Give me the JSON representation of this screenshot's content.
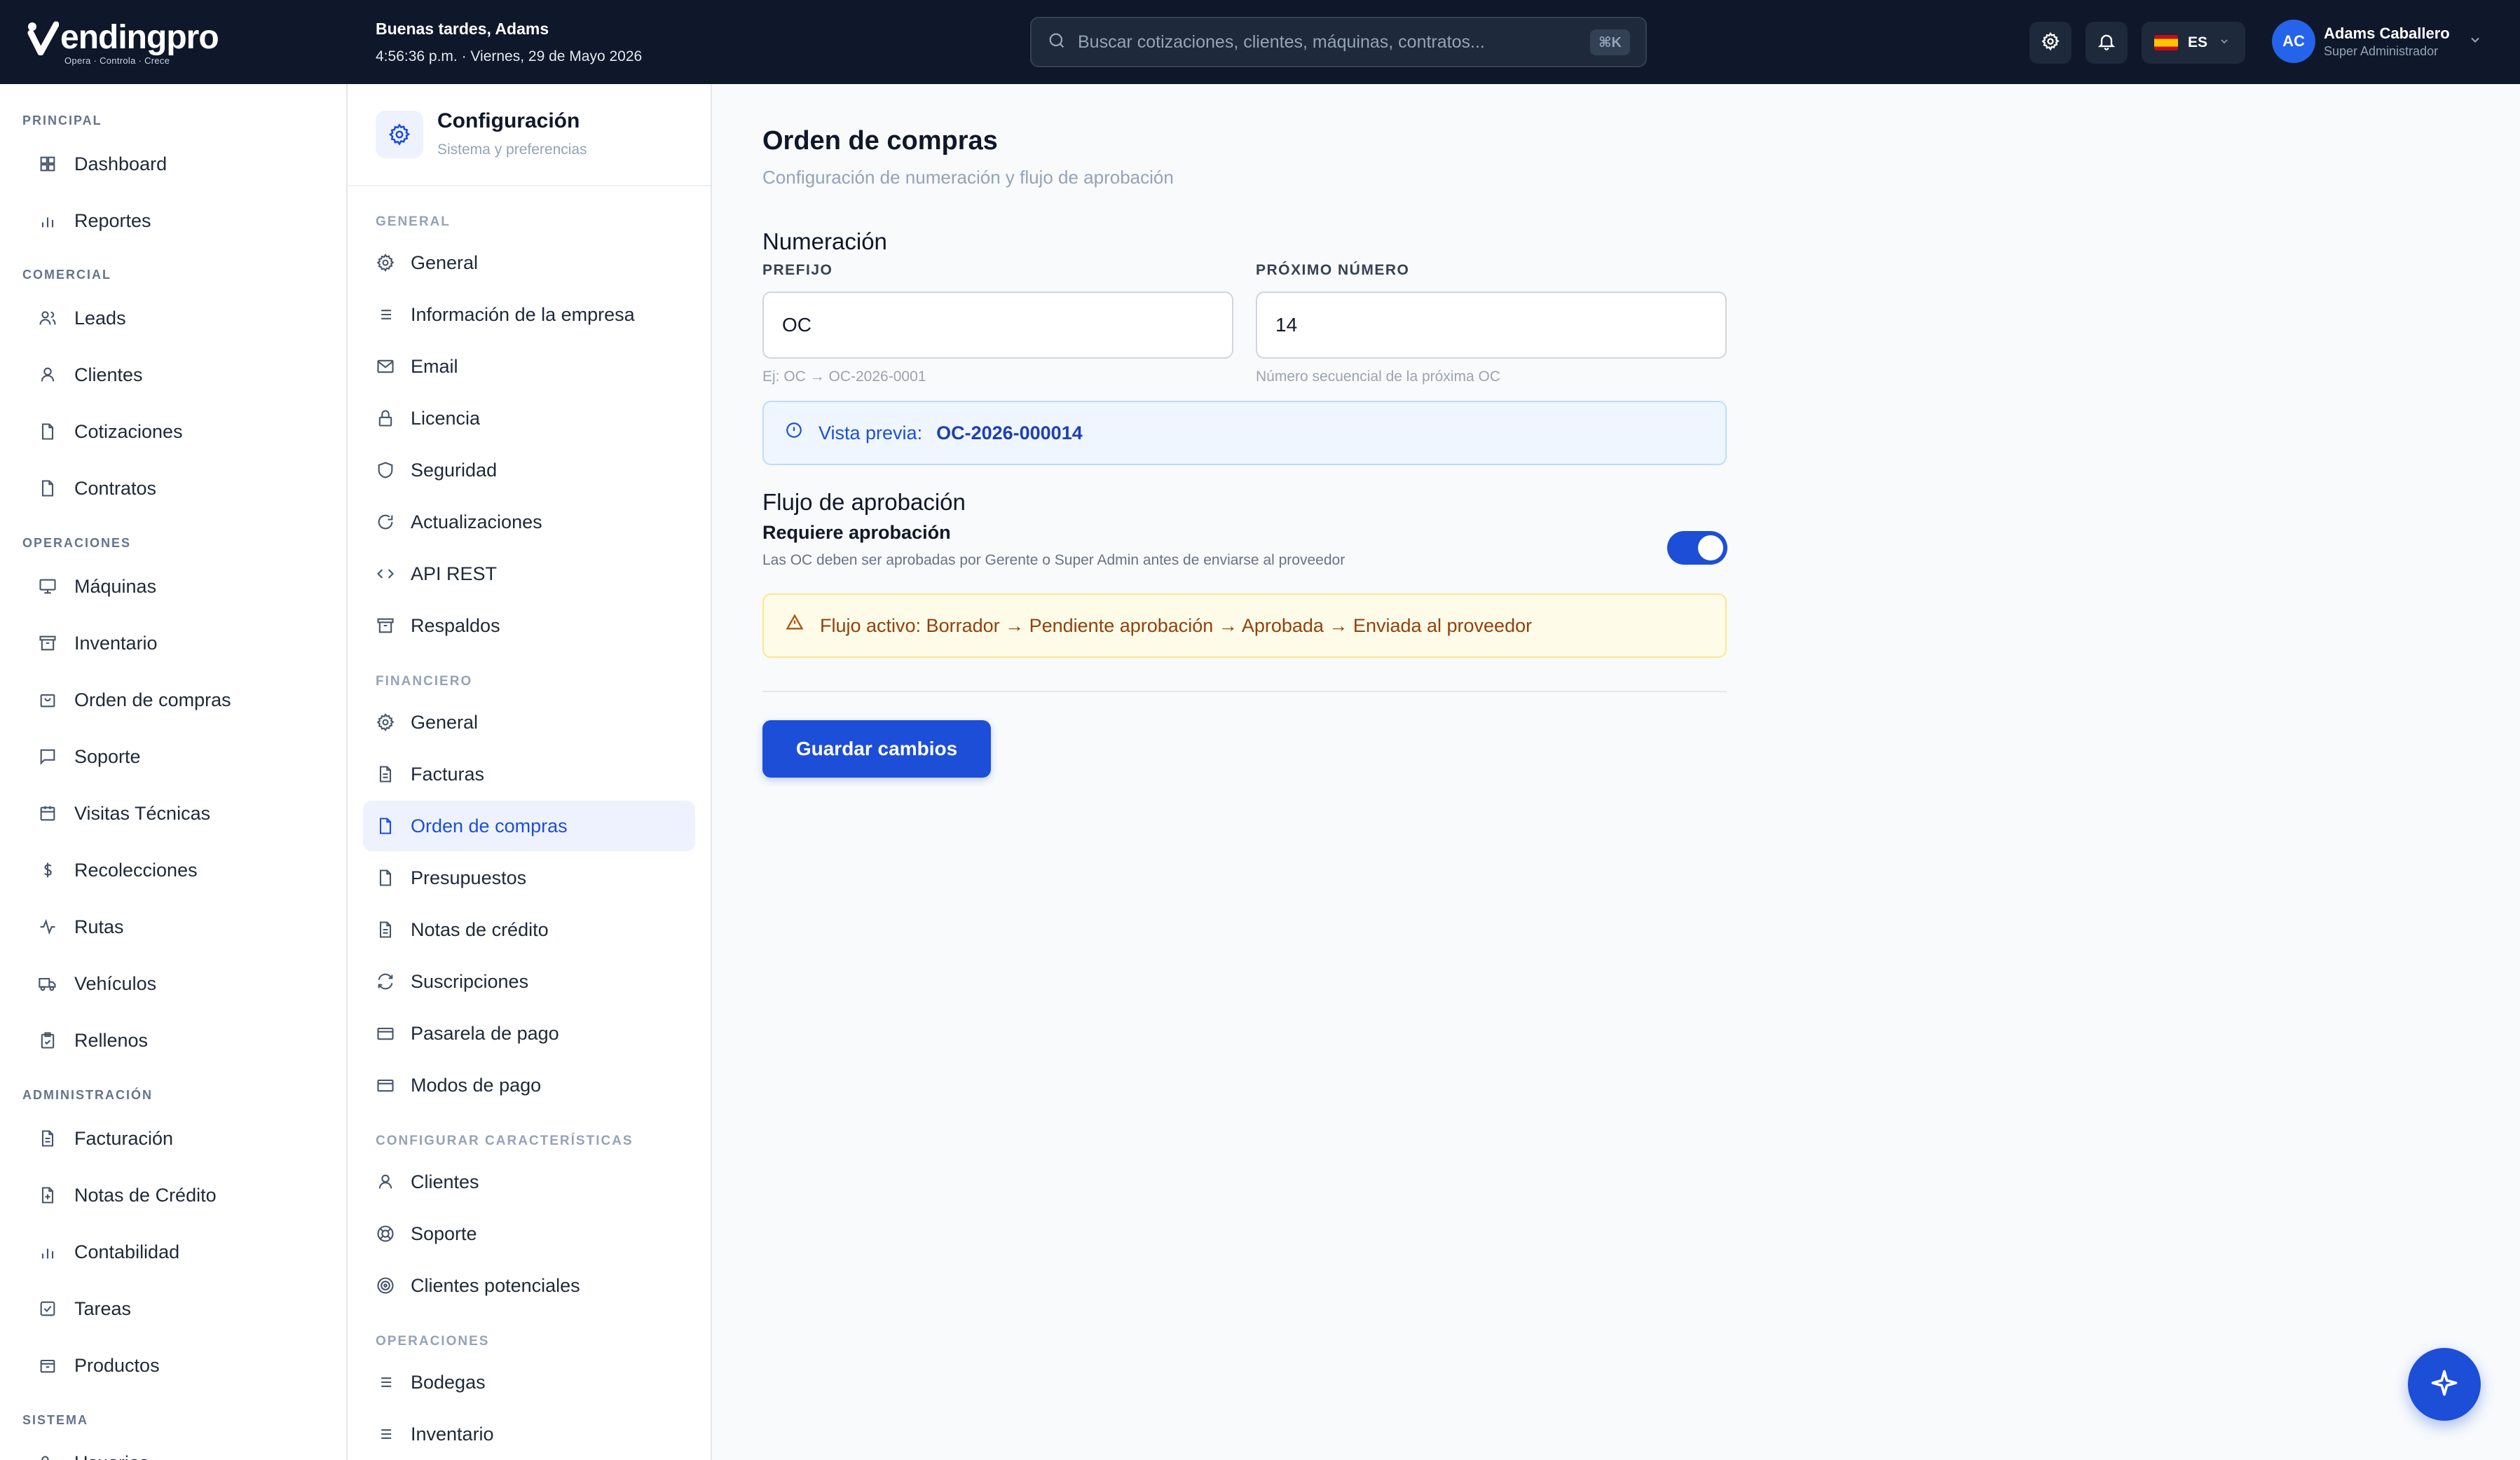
{
  "app": {
    "logo_text": "endingpro",
    "logo_tagline": "Opera · Controla · Crece",
    "greeting": "Buenas tardes, Adams",
    "datetime": "4:56:36 p.m. · Viernes, 29 de Mayo 2026",
    "search_placeholder": "Buscar cotizaciones, clientes, máquinas, contratos...",
    "search_shortcut": "⌘K",
    "language": "ES",
    "user": {
      "initials": "AC",
      "name": "Adams Caballero",
      "role": "Super Administrador"
    }
  },
  "sidebar": {
    "sections": [
      {
        "label": "PRINCIPAL",
        "items": [
          "Dashboard",
          "Reportes"
        ]
      },
      {
        "label": "COMERCIAL",
        "items": [
          "Leads",
          "Clientes",
          "Cotizaciones",
          "Contratos"
        ]
      },
      {
        "label": "OPERACIONES",
        "items": [
          "Máquinas",
          "Inventario",
          "Orden de compras",
          "Soporte",
          "Visitas Técnicas",
          "Recolecciones",
          "Rutas",
          "Vehículos",
          "Rellenos"
        ]
      },
      {
        "label": "ADMINISTRACIÓN",
        "items": [
          "Facturación",
          "Notas de Crédito",
          "Contabilidad",
          "Tareas",
          "Productos"
        ]
      },
      {
        "label": "SISTEMA",
        "items": [
          "Usuarios"
        ]
      }
    ]
  },
  "settings_nav": {
    "title": "Configuración",
    "subtitle": "Sistema y preferencias",
    "sections": [
      {
        "label": "GENERAL",
        "items": [
          "General",
          "Información de la empresa",
          "Email",
          "Licencia",
          "Seguridad",
          "Actualizaciones",
          "API REST",
          "Respaldos"
        ]
      },
      {
        "label": "FINANCIERO",
        "items": [
          "General",
          "Facturas",
          "Orden de compras",
          "Presupuestos",
          "Notas de crédito",
          "Suscripciones",
          "Pasarela de pago",
          "Modos de pago"
        ]
      },
      {
        "label": "CONFIGURAR CARACTERÍSTICAS",
        "items": [
          "Clientes",
          "Soporte",
          "Clientes potenciales"
        ]
      },
      {
        "label": "OPERACIONES",
        "items": [
          "Bodegas",
          "Inventario"
        ]
      }
    ],
    "active": "Orden de compras"
  },
  "main": {
    "title": "Orden de compras",
    "subtitle": "Configuración de numeración y flujo de aprobación",
    "numbering": {
      "section_title": "Numeración",
      "prefix_label": "PREFIJO",
      "prefix_value": "OC",
      "prefix_hint": "Ej: OC → OC-2026-0001",
      "next_label": "PRÓXIMO NÚMERO",
      "next_value": "14",
      "next_hint": "Número secuencial de la próxima OC",
      "preview_label": "Vista previa:",
      "preview_value": "OC-2026-000014"
    },
    "approval": {
      "section_title": "Flujo de aprobación",
      "require_title": "Requiere aprobación",
      "require_desc": "Las OC deben ser aprobadas por Gerente o Super Admin antes de enviarse al proveedor",
      "enabled": true,
      "flow_text": "Flujo activo: Borrador → Pendiente aprobación → Aprobada → Enviada al proveedor"
    },
    "save_label": "Guardar cambios"
  },
  "colors": {
    "topbar": "#0f172a",
    "accent": "#1d4ed8",
    "active_bg": "#eef2ff"
  }
}
